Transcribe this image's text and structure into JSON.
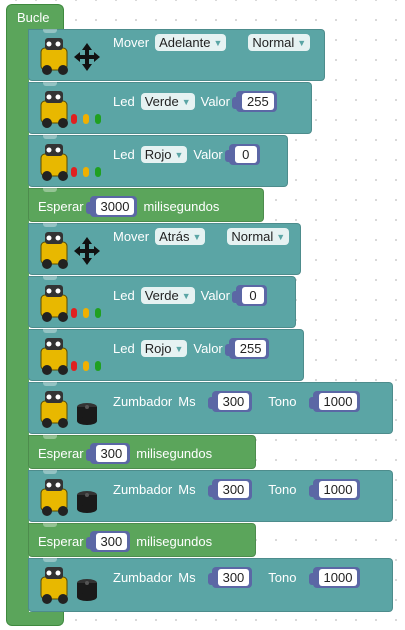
{
  "loop": {
    "label": "Bucle"
  },
  "blocks": [
    {
      "kind": "move",
      "label": "Mover",
      "direction": "Adelante",
      "speed": "Normal"
    },
    {
      "kind": "led",
      "label": "Led",
      "color": "Verde",
      "value_label": "Valor",
      "value": "255"
    },
    {
      "kind": "led",
      "label": "Led",
      "color": "Rojo",
      "value_label": "Valor",
      "value": "0"
    },
    {
      "kind": "wait",
      "label": "Esperar",
      "value": "3000",
      "unit": "milisegundos"
    },
    {
      "kind": "move",
      "label": "Mover",
      "direction": "Atrás",
      "speed": "Normal"
    },
    {
      "kind": "led",
      "label": "Led",
      "color": "Verde",
      "value_label": "Valor",
      "value": "0"
    },
    {
      "kind": "led",
      "label": "Led",
      "color": "Rojo",
      "value_label": "Valor",
      "value": "255"
    },
    {
      "kind": "buzzer",
      "label": "Zumbador",
      "ms_label": "Ms",
      "ms": "300",
      "tone_label": "Tono",
      "tone": "1000"
    },
    {
      "kind": "wait",
      "label": "Esperar",
      "value": "300",
      "unit": "milisegundos"
    },
    {
      "kind": "buzzer",
      "label": "Zumbador",
      "ms_label": "Ms",
      "ms": "300",
      "tone_label": "Tono",
      "tone": "1000"
    },
    {
      "kind": "wait",
      "label": "Esperar",
      "value": "300",
      "unit": "milisegundos"
    },
    {
      "kind": "buzzer",
      "label": "Zumbador",
      "ms_label": "Ms",
      "ms": "300",
      "tone_label": "Tono",
      "tone": "1000"
    }
  ],
  "colors": {
    "robot_block": "#5ba5a5",
    "wait_block": "#5ba55b",
    "loop_block": "#5ba55b",
    "number_socket": "#5b67a5"
  },
  "icons": {
    "robot": "robot-icon",
    "arrows": "move-arrows-icon",
    "leds": "traffic-led-icon",
    "buzzer": "buzzer-icon"
  }
}
